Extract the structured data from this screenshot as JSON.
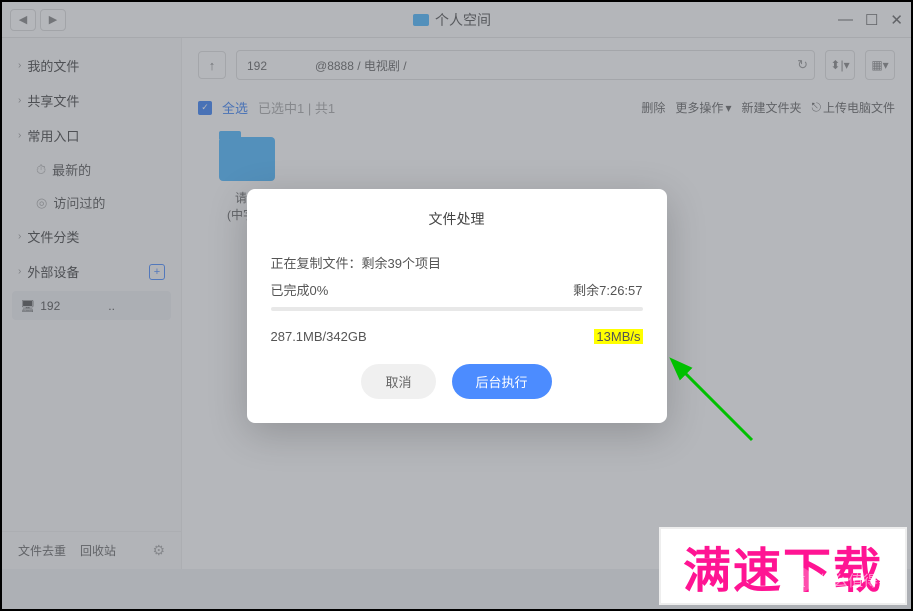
{
  "titlebar": {
    "title": "个人空间"
  },
  "sidebar": {
    "my_files": "我的文件",
    "shared_files": "共享文件",
    "common_entry": "常用入口",
    "recent": "最新的",
    "visited": "访问过的",
    "file_category": "文件分类",
    "external_device": "外部设备",
    "device_label": "192　　　　..",
    "footer_dedup": "文件去重",
    "footer_recycle": "回收站"
  },
  "pathbar": {
    "path": "192　　　　@8888 / 电视剧 /"
  },
  "actionbar": {
    "select_all": "全选",
    "selected_info": "已选中1 | 共1",
    "delete": "删除",
    "more_ops": "更多操作",
    "new_folder": "新建文件夹",
    "upload": "上传电脑文件"
  },
  "file": {
    "name_l1": "请…",
    "name_l2": "(中字…"
  },
  "dialog": {
    "title": "文件处理",
    "copying": "正在复制文件：剩余39个项目",
    "done_pct": "已完成0%",
    "remaining": "剩余7:26:57",
    "size": "287.1MB/342GB",
    "speed": "13MB/s",
    "cancel": "取消",
    "background": "后台执行"
  },
  "banner": "满速下载",
  "watermark": "什么值得买"
}
